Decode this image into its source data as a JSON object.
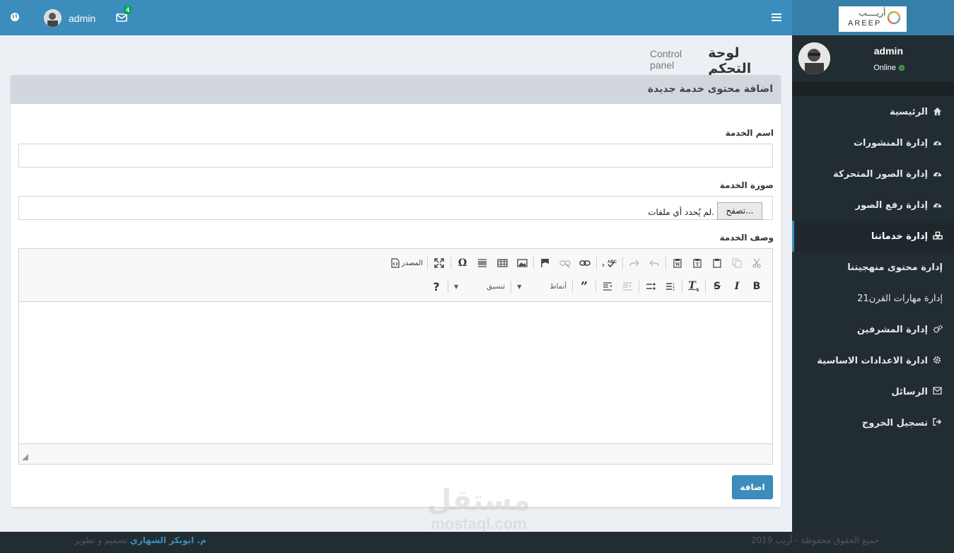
{
  "header": {
    "username": "admin",
    "mail_count": "4"
  },
  "logo": {
    "arabic": "أريــــب",
    "english": "AREEP"
  },
  "user_panel": {
    "name": "admin",
    "status": "Online"
  },
  "sidebar": {
    "items": [
      {
        "label": "الرئيسية",
        "icon": "home-icon"
      },
      {
        "label": "إدارة المنشورات",
        "icon": "dashboard-icon"
      },
      {
        "label": "إدارة الصور المتحركة",
        "icon": "dashboard-icon"
      },
      {
        "label": "إدارة رفع الصور",
        "icon": "dashboard-icon"
      },
      {
        "label": "إدارة خدماتنا",
        "icon": "cubes-icon"
      },
      {
        "label": "إدارة محتوى منهجيتنا",
        "icon": ""
      },
      {
        "label": "إدارة مهارات القرن21",
        "icon": ""
      },
      {
        "label": "إدارة المشرفين",
        "icon": "gears-icon"
      },
      {
        "label": "ادارة الاعدادات الاساسية",
        "icon": "gear-icon"
      },
      {
        "label": "الرسائل",
        "icon": "envelope-icon"
      },
      {
        "label": "تسجيل الخروج",
        "icon": "sign-out-icon"
      }
    ],
    "active_index": 4
  },
  "page": {
    "title": "لوحة التحكم",
    "subtitle": "Control panel"
  },
  "form": {
    "box_title": "اضافة محتوى خدمة جديدة",
    "name_label": "اسم الخدمة",
    "name_value": "",
    "image_label": "صورة الخدمة",
    "browse_label": "تصفح...",
    "no_file_text": "لم يُحدد أي ملفات.",
    "desc_label": "وصف الخدمة",
    "editor_source": "المصدر",
    "editor_styles": "أنماط",
    "editor_format": "تنسيق",
    "submit_label": "اضافة"
  },
  "footer": {
    "designer_prefix": "تصميم و تطوير",
    "designer_name": "م. ابوبكر الشهاري",
    "copyright": "جميع الحقوق محفوظة - أريب 2019"
  },
  "watermark": {
    "arabic": "مستقل",
    "english": "mostaql.com"
  },
  "colors": {
    "primary": "#3c8dbc",
    "sidebar": "#222d32",
    "badge": "#00a65a"
  }
}
